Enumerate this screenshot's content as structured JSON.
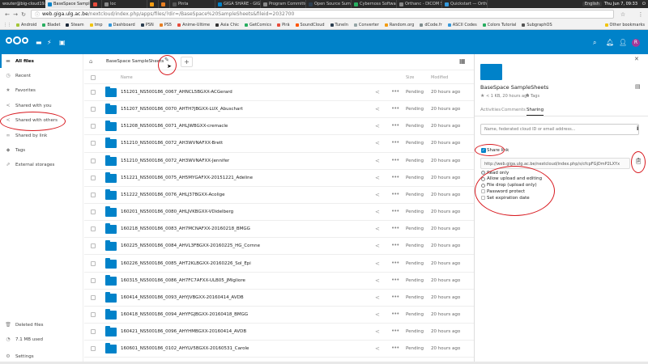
{
  "os": {
    "user_tab": "wouter@big-cloud19...",
    "tabs": [
      {
        "label": "BaseSpace SampleS...",
        "active": true,
        "color": "#0082c9"
      },
      {
        "label": "",
        "active": false,
        "color": "#e74c3c"
      },
      {
        "label": "loc",
        "active": false,
        "color": "#888888"
      },
      {
        "label": "",
        "active": false,
        "color": "#f39c12"
      },
      {
        "label": "",
        "active": false,
        "color": "#e67e22"
      },
      {
        "label": "Pinta",
        "active": false,
        "color": "#555555"
      },
      {
        "label": "GIGA SHARE - GIGA I...",
        "active": false,
        "color": "#0082c9"
      },
      {
        "label": "Program Committee...",
        "active": false,
        "color": "#888888"
      },
      {
        "label": "Open Source Summit...",
        "active": false,
        "color": "#2c3e50"
      },
      {
        "label": "Cybernoss Software...",
        "active": false,
        "color": "#27ae60"
      },
      {
        "label": "Orthanc - DICOM Serv...",
        "active": false,
        "color": "#888888"
      },
      {
        "label": "Quickstart — Orthanc...",
        "active": false,
        "color": "#3498db"
      }
    ],
    "keyboard": "English",
    "clock": "Thu Jun 7, 09:33"
  },
  "browser": {
    "url_host": "web.giga.ulg.ac.be",
    "url_path": "/nextcloud/index.php/apps/files/?dir=/BaseSpace%20SampleSheets&fileid=2032700",
    "bookmarks": [
      {
        "label": "Android",
        "color": "#a4c639"
      },
      {
        "label": "Bladet",
        "color": "#27ae60"
      },
      {
        "label": "Steam",
        "color": "#1b2838"
      },
      {
        "label": "tmp",
        "color": "#f1c40f"
      },
      {
        "label": "Dashboard",
        "color": "#3498db"
      },
      {
        "label": "PSN",
        "color": "#2c3e50"
      },
      {
        "label": "PS5",
        "color": "#e67e22"
      },
      {
        "label": "Anime-Ultime",
        "color": "#e74c3c"
      },
      {
        "label": "Asia Chic",
        "color": "#333333"
      },
      {
        "label": "GetComics",
        "color": "#27ae60"
      },
      {
        "label": "Pirã",
        "color": "#e74c3c"
      },
      {
        "label": "SoundCloud",
        "color": "#ff5500"
      },
      {
        "label": "TuneIn",
        "color": "#2c3e50"
      },
      {
        "label": "Converter",
        "color": "#95a5a6"
      },
      {
        "label": "Random.org",
        "color": "#f39c12"
      },
      {
        "label": "dCode.fr",
        "color": "#7f8c8d"
      },
      {
        "label": "ASCII Codes",
        "color": "#3498db"
      },
      {
        "label": "Colors Tutorial",
        "color": "#27ae60"
      },
      {
        "label": "SubgraphOS",
        "color": "#555555"
      }
    ],
    "other_bookmarks": "Other bookmarks"
  },
  "sidebar": {
    "items": [
      {
        "label": "All files",
        "icon": "folder-icon",
        "glyph": "▬",
        "active": true
      },
      {
        "label": "Recent",
        "icon": "clock-icon",
        "glyph": "◷",
        "active": false
      },
      {
        "label": "Favorites",
        "icon": "star-icon",
        "glyph": "★",
        "active": false
      },
      {
        "label": "Shared with you",
        "icon": "share-icon",
        "glyph": "<",
        "active": false
      },
      {
        "label": "Shared with others",
        "icon": "share-icon",
        "glyph": "<",
        "active": false
      },
      {
        "label": "Shared by link",
        "icon": "link-icon",
        "glyph": "∞",
        "active": false
      },
      {
        "label": "Tags",
        "icon": "tag-icon",
        "glyph": "◆",
        "active": false
      },
      {
        "label": "External storages",
        "icon": "external-storage-icon",
        "glyph": "⇗",
        "active": false
      }
    ],
    "deleted": "Deleted files",
    "usage": "7.1 MB used",
    "settings": "Settings"
  },
  "files": {
    "breadcrumb": "BaseSpace SampleSheets",
    "headers": {
      "name": "Name",
      "size": "Size",
      "modified": "Modified"
    },
    "rows": [
      {
        "name": "151201_NS500186_0067_AHNCL5BGXX-ACGerard",
        "size": "Pending",
        "modified": "20 hours ago"
      },
      {
        "name": "151207_NS500186_0070_AHTH7JBGXX-LUX_Abuschart",
        "size": "Pending",
        "modified": "20 hours ago"
      },
      {
        "name": "151208_NS500186_0071_AHLJWBGXX-cremacle",
        "size": "Pending",
        "modified": "20 hours ago"
      },
      {
        "name": "151210_NS500186_0072_AH3WVNAFXX-Brett",
        "size": "Pending",
        "modified": "20 hours ago"
      },
      {
        "name": "151210_NS500186_0072_AH3WVNAFXX-Jennifer",
        "size": "Pending",
        "modified": "20 hours ago"
      },
      {
        "name": "151221_NS500186_0075_AH5MYGAFXX-20151221_Adeline",
        "size": "Pending",
        "modified": "20 hours ago"
      },
      {
        "name": "151222_NS500186_0076_AHLJ37BGXX-Acolige",
        "size": "Pending",
        "modified": "20 hours ago"
      },
      {
        "name": "160201_NS500186_0080_AHLJVKBGXX-VDidelberg",
        "size": "Pending",
        "modified": "20 hours ago"
      },
      {
        "name": "160218_NS500186_0083_AH7MCNAFXX-20160218_BMGG",
        "size": "Pending",
        "modified": "20 hours ago"
      },
      {
        "name": "160225_NS500186_0084_AHVL3FBGXX-20160225_HG_Cornne",
        "size": "Pending",
        "modified": "20 hours ago"
      },
      {
        "name": "160226_NS500186_0085_AHT2KLBGXX-20160226_Sol_Epi",
        "size": "Pending",
        "modified": "20 hours ago"
      },
      {
        "name": "160315_NS500186_0086_AH7FC7AFXX-ULB05_JMigliore",
        "size": "Pending",
        "modified": "20 hours ago"
      },
      {
        "name": "160414_NS500186_0093_AHYJVBGXX-20160414_AVDB",
        "size": "Pending",
        "modified": "20 hours ago"
      },
      {
        "name": "160418_NS500186_0094_AHYFGJBGXX-20160418_BMGG",
        "size": "Pending",
        "modified": "20 hours ago"
      },
      {
        "name": "160421_NS500186_0096_AHYHMBGXX-20160414_AVDB",
        "size": "Pending",
        "modified": "20 hours ago"
      },
      {
        "name": "160601_NS500186_0102_AHYLV5BGXX-20160531_Carole",
        "size": "Pending",
        "modified": "20 hours ago"
      }
    ]
  },
  "details": {
    "title": "BaseSpace SampleSheets",
    "meta": "< 1 KB, 20 hours ago",
    "tags_label": "Tags",
    "tabs": [
      {
        "label": "Activities",
        "active": false
      },
      {
        "label": "Comments",
        "active": false
      },
      {
        "label": "Sharing",
        "active": true
      }
    ],
    "share_placeholder": "Name, federated cloud ID or email address...",
    "share_link_label": "Share link",
    "share_url": "http://web.giga.ulg.ac.be/nextcloud/index.php/s/cfcpFGjDmP2LXYx",
    "options": [
      {
        "label": "Read only",
        "type": "radio",
        "checked": true
      },
      {
        "label": "Allow upload and editing",
        "type": "radio",
        "checked": false
      },
      {
        "label": "File drop (upload only)",
        "type": "radio",
        "checked": false
      },
      {
        "label": "Password protect",
        "type": "checkbox",
        "checked": false
      },
      {
        "label": "Set expiration date",
        "type": "checkbox",
        "checked": false
      }
    ]
  },
  "colors": {
    "brand": "#0082c9",
    "annotation": "#d8191f"
  }
}
